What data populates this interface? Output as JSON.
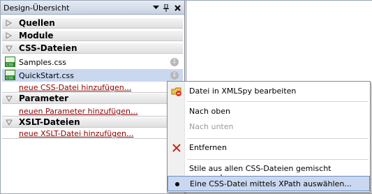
{
  "panel": {
    "title": "Design-Übersicht",
    "pin_icon": "pin-icon",
    "close_icon": "close-icon",
    "dropdown_icon": "dropdown-arrow-icon"
  },
  "sections": {
    "quellen": "Quellen",
    "module": "Module",
    "css": "CSS-Dateien",
    "parameter": "Parameter",
    "xslt": "XSLT-Dateien"
  },
  "css_files": [
    {
      "name": "Samples.css"
    },
    {
      "name": "QuickStart.css"
    }
  ],
  "links": {
    "add_css": "neue CSS-Datei hinzufügen...",
    "add_param": "neuen Parameter hinzufügen...",
    "add_xslt": "neue XSLT-Datei hinzufügen..."
  },
  "context_menu": {
    "items": [
      "Datei in XMLSpy bearbeiten",
      "Nach oben",
      "Nach unten",
      "Entfernen",
      "Stile aus allen CSS-Dateien gemischt verwenden",
      "Eine CSS-Datei mittels XPath auswählen..."
    ]
  }
}
